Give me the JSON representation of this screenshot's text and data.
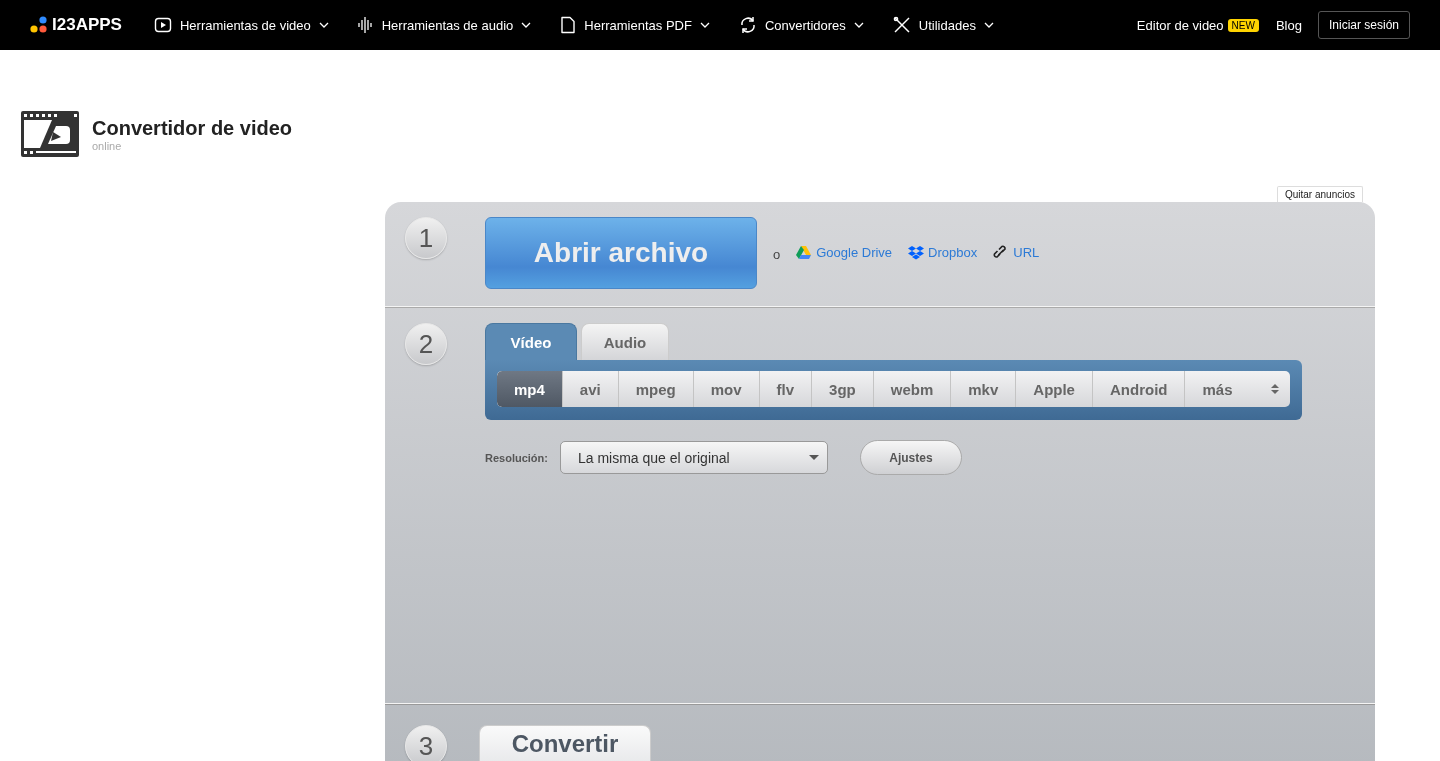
{
  "nav": {
    "logo": "I23APPS",
    "menus": [
      {
        "kind": "video",
        "label": "Herramientas de video"
      },
      {
        "kind": "audio",
        "label": "Herramientas de audio"
      },
      {
        "kind": "pdf",
        "label": "Herramientas PDF"
      },
      {
        "kind": "converters",
        "label": "Convertidores"
      },
      {
        "kind": "utilities",
        "label": "Utilidades"
      }
    ],
    "editor": {
      "label": "Editor de video",
      "badge": "NEW"
    },
    "blog": "Blog",
    "login": "Iniciar sesión"
  },
  "header": {
    "title": "Convertidor de video",
    "subtitle": "online"
  },
  "remove_ads": "Quitar anuncios",
  "step1": {
    "number": "1",
    "open_button": "Abrir archivo",
    "or": "o",
    "sources": [
      {
        "kind": "drive",
        "label": "Google Drive"
      },
      {
        "kind": "dropbox",
        "label": "Dropbox"
      },
      {
        "kind": "link",
        "label": "URL"
      }
    ]
  },
  "step2": {
    "number": "2",
    "tabs": [
      {
        "label": "Vídeo",
        "selected": true
      },
      {
        "label": "Audio",
        "selected": false
      }
    ],
    "formats": [
      {
        "label": "mp4",
        "selected": true
      },
      {
        "label": "avi",
        "selected": false
      },
      {
        "label": "mpeg",
        "selected": false
      },
      {
        "label": "mov",
        "selected": false
      },
      {
        "label": "flv",
        "selected": false
      },
      {
        "label": "3gp",
        "selected": false
      },
      {
        "label": "webm",
        "selected": false
      },
      {
        "label": "mkv",
        "selected": false
      },
      {
        "label": "Apple",
        "selected": false
      },
      {
        "label": "Android",
        "selected": false
      }
    ],
    "more": "más",
    "resolution_label": "Resolución:",
    "resolution_value": "La misma que el original",
    "settings_button": "Ajustes"
  },
  "step3": {
    "number": "3",
    "convert_button": "Convertir"
  }
}
